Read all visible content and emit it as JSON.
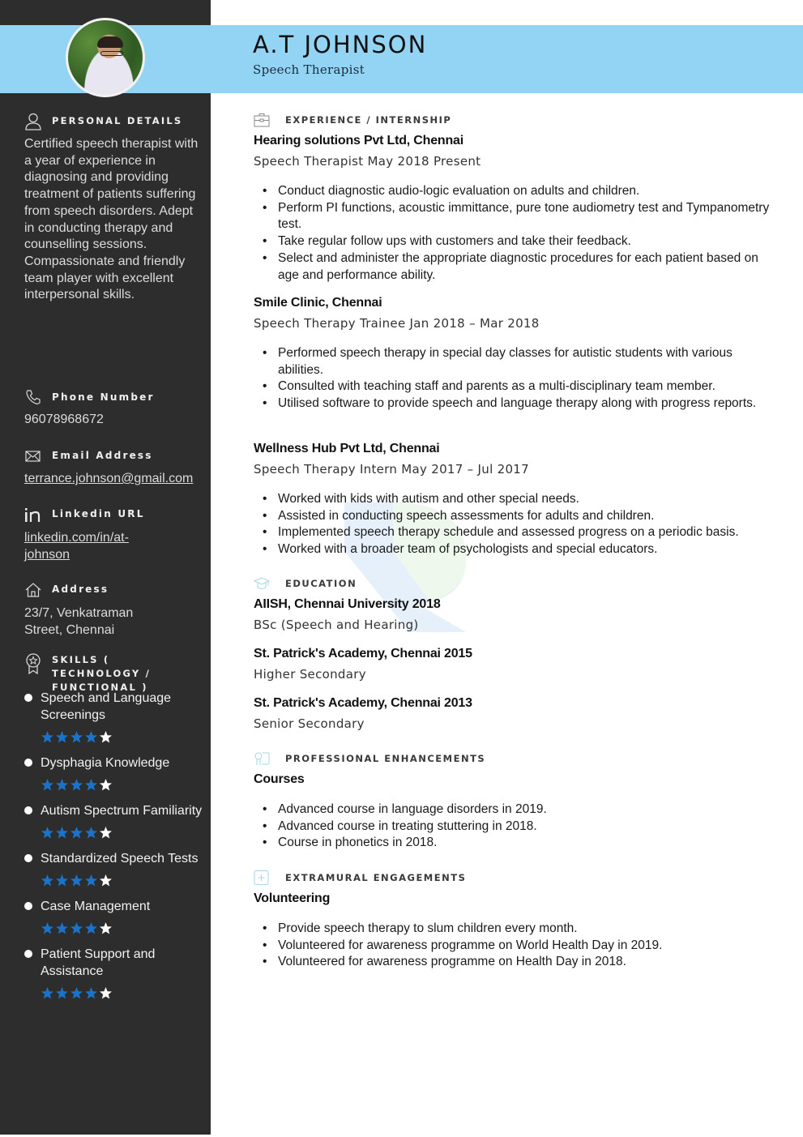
{
  "header": {
    "name": "A.T JOHNSON",
    "title": "Speech Therapist"
  },
  "sidebar": {
    "personal": {
      "label": "PERSONAL DETAILS",
      "icon": "user-icon",
      "summary": "Certified speech therapist with a year of experience in diagnosing and providing treatment of patients suffering from speech disorders. Adept in conducting therapy and counselling sessions. Compassionate and friendly team player with excellent interpersonal skills."
    },
    "phone": {
      "label": "Phone Number",
      "icon": "phone-icon",
      "value": "96078968672"
    },
    "email": {
      "label": "Email Address",
      "icon": "envelope-icon",
      "value": "terrance.johnson@gmail.com"
    },
    "linkedin": {
      "label": "Linkedin URL",
      "icon": "linkedin-icon",
      "value": "linkedin.com/in/at-johnson"
    },
    "address": {
      "label": "Address",
      "icon": "home-icon",
      "value": "23/7, Venkatraman Street, Chennai"
    },
    "skills": {
      "label": "SKILLS ( TECHNOLOGY / FUNCTIONAL )",
      "icon": "award-icon",
      "rating_max": 5,
      "filled_color": "#1a73c8",
      "empty_color": "#ffffff",
      "items": [
        {
          "name": "Speech and Language Screenings",
          "rating": 4
        },
        {
          "name": "Dysphagia Knowledge",
          "rating": 4
        },
        {
          "name": "Autism Spectrum Familiarity",
          "rating": 4
        },
        {
          "name": "Standardized Speech Tests",
          "rating": 4
        },
        {
          "name": "Case Management",
          "rating": 4
        },
        {
          "name": "Patient Support and Assistance",
          "rating": 4
        }
      ]
    }
  },
  "main": {
    "experience": {
      "label": "EXPERIENCE / INTERNSHIP",
      "icon": "briefcase-icon",
      "jobs": [
        {
          "org": "Hearing solutions Pvt Ltd, Chennai",
          "role": "Speech Therapist May 2018 Present",
          "bullets": [
            "Conduct diagnostic audio-logic evaluation on adults and children.",
            "Perform PI functions, acoustic immittance, pure tone audiometry test and Tympanometry test.",
            "Take regular follow ups with customers and take their feedback.",
            "Select and administer the appropriate diagnostic procedures for each patient based on age and performance ability."
          ]
        },
        {
          "org": "Smile Clinic, Chennai",
          "role": "Speech Therapy Trainee Jan 2018 – Mar 2018",
          "bullets": [
            "Performed speech therapy in special day classes for autistic students with various abilities.",
            "Consulted with teaching staff and parents as a multi-disciplinary team member.",
            "Utilised software to provide speech and language therapy along with progress reports."
          ]
        },
        {
          "org": "Wellness Hub Pvt Ltd, Chennai",
          "role": "Speech Therapy Intern May 2017 – Jul 2017",
          "bullets": [
            "Worked with kids with autism and other special needs.",
            "Assisted in conducting speech assessments for adults and children.",
            "Implemented speech therapy schedule and assessed progress on a periodic basis.",
            "Worked with a broader team of psychologists and special educators."
          ]
        }
      ]
    },
    "education": {
      "label": "EDUCATION",
      "icon": "graduation-cap-icon",
      "items": [
        {
          "school": "AIISH, Chennai University 2018",
          "degree": "BSc (Speech and Hearing)"
        },
        {
          "school": "St. Patrick's Academy, Chennai 2015",
          "degree": "Higher Secondary"
        },
        {
          "school": "St. Patrick's Academy, Chennai 2013",
          "degree": "Senior Secondary"
        }
      ]
    },
    "enhancements": {
      "label": "PROFESSIONAL ENHANCEMENTS",
      "icon": "certificate-icon",
      "subhead": "Courses",
      "bullets": [
        "Advanced course in language disorders in 2019.",
        "Advanced course in treating stuttering in 2018.",
        "Course in phonetics in 2018."
      ]
    },
    "extramural": {
      "label": "EXTRAMURAL ENGAGEMENTS",
      "icon": "plus-box-icon",
      "subhead": "Volunteering",
      "bullets": [
        "Provide speech therapy to slum children every month.",
        "Volunteered for awareness programme on World Health Day in 2019.",
        "Volunteered for awareness programme on Health Day in 2018."
      ]
    }
  }
}
